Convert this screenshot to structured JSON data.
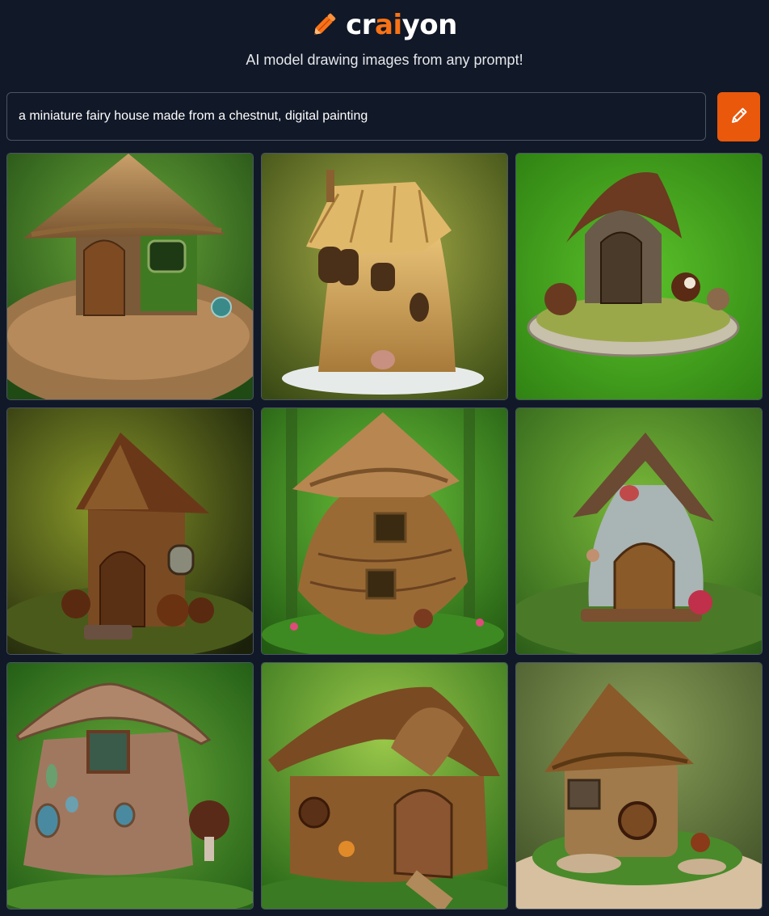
{
  "app": {
    "logo_prefix": "cr",
    "logo_accent": "ai",
    "logo_suffix": "yon",
    "tagline": "AI model drawing images from any prompt!"
  },
  "prompt": {
    "value": "a miniature fairy house made from a chestnut, digital painting",
    "draw_button_icon": "pencil-icon"
  },
  "colors": {
    "background": "#111827",
    "accent": "#f97316",
    "button": "#ea580c"
  },
  "results": [
    {
      "name": "fairy-house-image-1"
    },
    {
      "name": "fairy-house-image-2"
    },
    {
      "name": "fairy-house-image-3"
    },
    {
      "name": "fairy-house-image-4"
    },
    {
      "name": "fairy-house-image-5"
    },
    {
      "name": "fairy-house-image-6"
    },
    {
      "name": "fairy-house-image-7"
    },
    {
      "name": "fairy-house-image-8"
    },
    {
      "name": "fairy-house-image-9"
    }
  ]
}
